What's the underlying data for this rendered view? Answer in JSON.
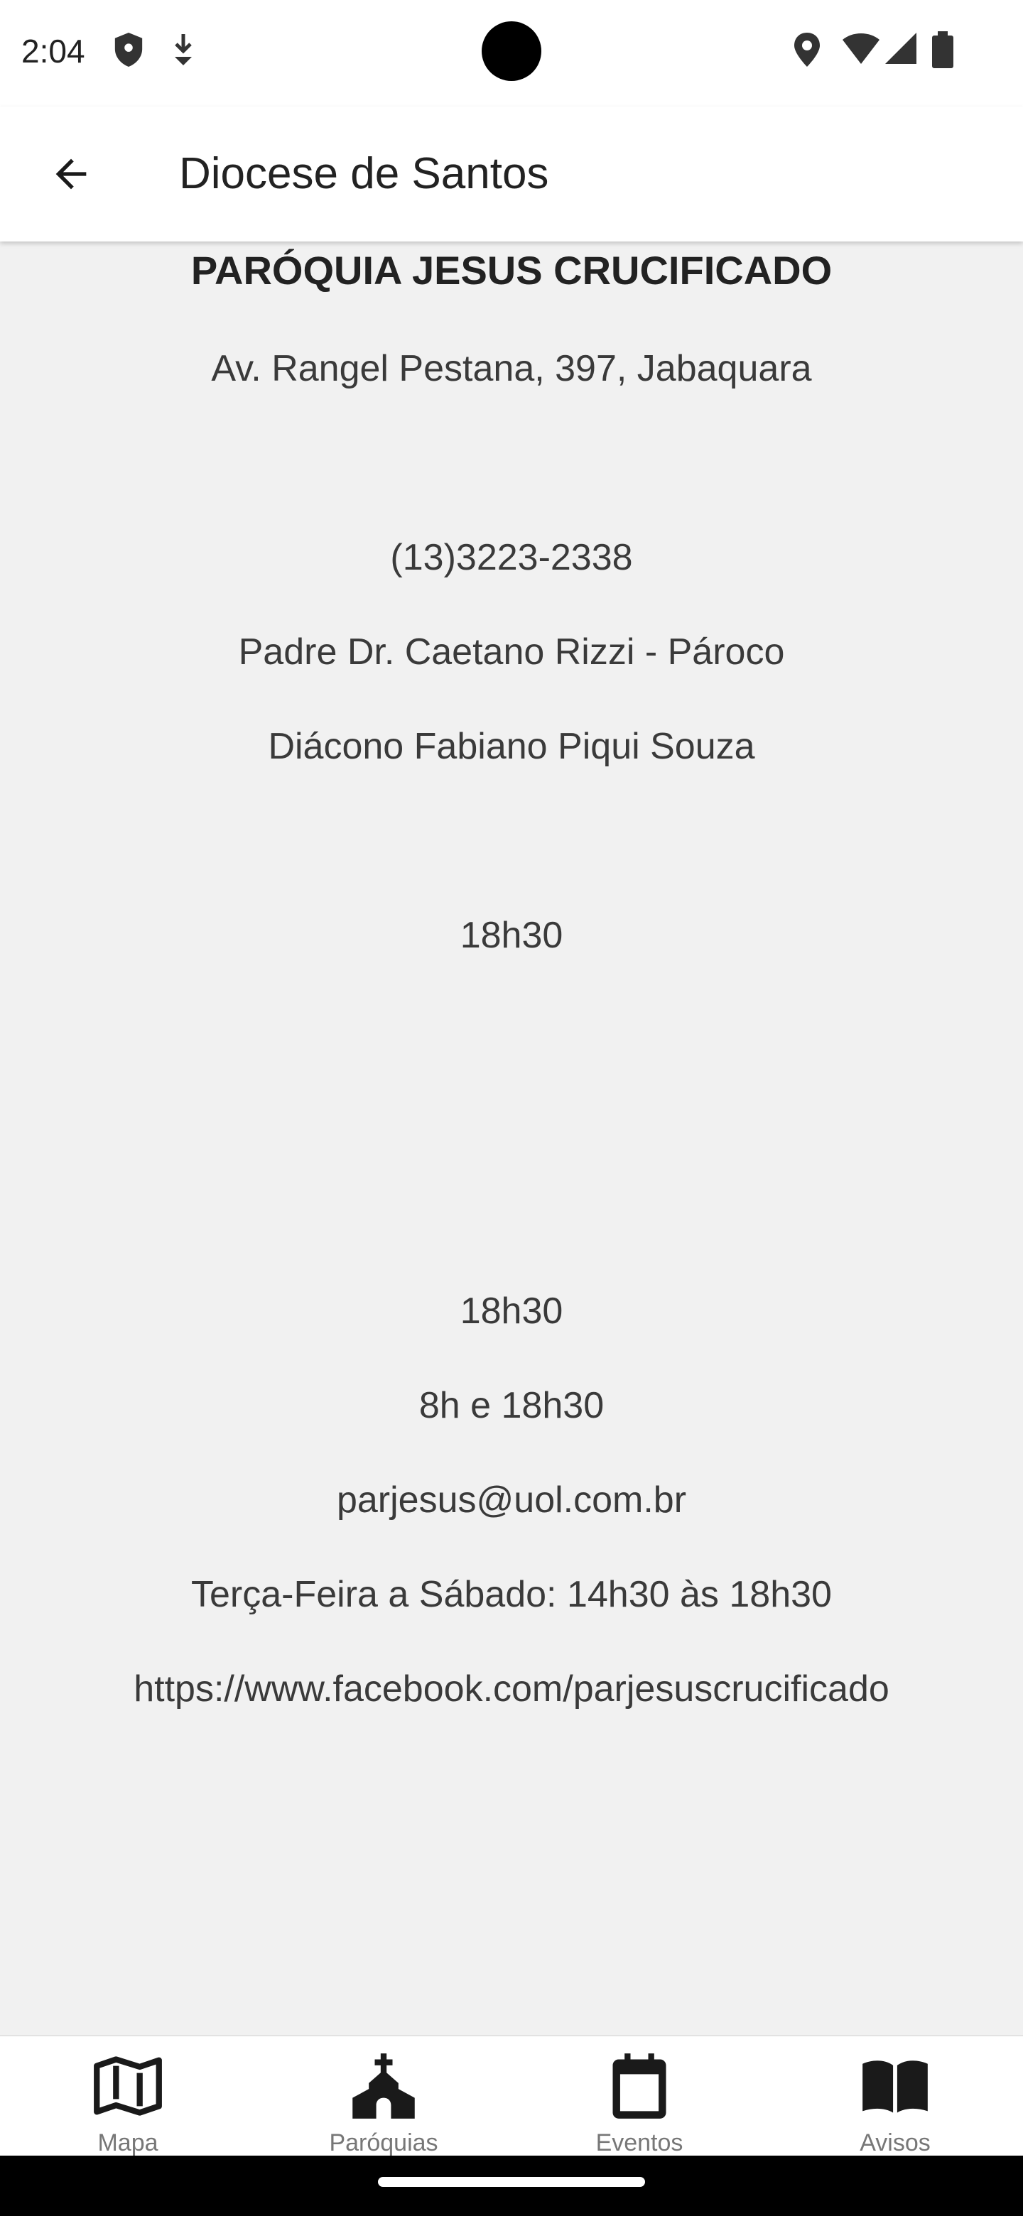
{
  "status_bar": {
    "time": "2:04",
    "icons": [
      "shield-icon",
      "download-icon",
      "location-icon",
      "wifi-icon",
      "signal-icon",
      "battery-icon"
    ]
  },
  "app_bar": {
    "back_icon": "arrow-left-icon",
    "title": "Diocese de Santos"
  },
  "parish": {
    "name": "PARÓQUIA JESUS CRUCIFICADO",
    "address": "Av. Rangel Pestana, 397, Jabaquara",
    "phone": "(13)3223-2338",
    "priest": "Padre Dr. Caetano Rizzi - Pároco",
    "deacon": "Diácono Fabiano Piqui Souza",
    "schedule_1": "18h30",
    "schedule_2": "18h30",
    "schedule_3": "8h e 18h30",
    "email": "parjesus@uol.com.br",
    "office_hours": "Terça-Feira a Sábado: 14h30 às 18h30",
    "facebook": "https://www.facebook.com/parjesuscrucificado"
  },
  "bottom_nav": {
    "items": [
      {
        "label": "Mapa",
        "icon": "map-icon"
      },
      {
        "label": "Paróquias",
        "icon": "church-icon"
      },
      {
        "label": "Eventos",
        "icon": "calendar-icon"
      },
      {
        "label": "Avisos",
        "icon": "book-icon"
      }
    ]
  },
  "colors": {
    "background": "#f1f1f1",
    "app_bar": "#ffffff",
    "text": "#3a3a3a",
    "icon": "#1a1a1a",
    "nav_label": "#777777"
  }
}
